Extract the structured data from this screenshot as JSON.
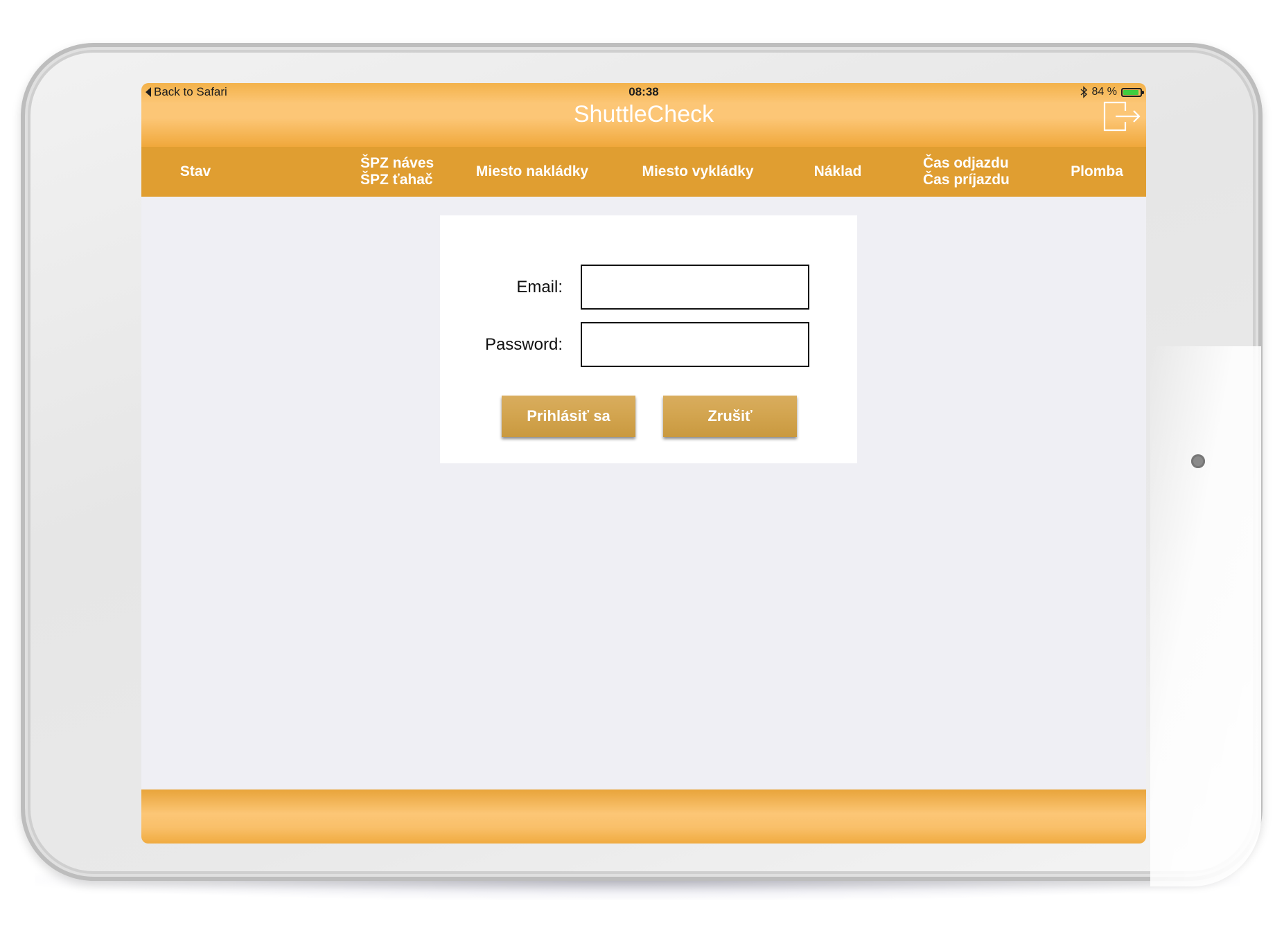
{
  "status_bar": {
    "back_label": "Back to Safari",
    "time": "08:38",
    "battery_text": "84 %",
    "battery_level": 0.84
  },
  "app": {
    "title": "ShuttleCheck"
  },
  "columns": {
    "stav": "Stav",
    "spz_naves": "ŠPZ náves",
    "spz_tahac": "ŠPZ ťahač",
    "miesto_nakladky": "Miesto nakládky",
    "miesto_vykladky": "Miesto vykládky",
    "naklad": "Náklad",
    "cas_odjazdu": "Čas odjazdu",
    "cas_prijazdu": "Čas príjazdu",
    "plomba": "Plomba"
  },
  "login": {
    "email_label": "Email:",
    "email_value": "",
    "password_label": "Password:",
    "password_value": "",
    "login_button": "Prihlásiť sa",
    "cancel_button": "Zrušiť"
  },
  "colors": {
    "bar_orange": "#e09e31",
    "bar_light": "#fcc676",
    "button_gold": "#d3a550",
    "screen_bg": "#efeff4"
  },
  "icons": {
    "back": "back-triangle-icon",
    "bluetooth": "bluetooth-icon",
    "battery": "battery-icon",
    "logout": "logout-icon"
  }
}
